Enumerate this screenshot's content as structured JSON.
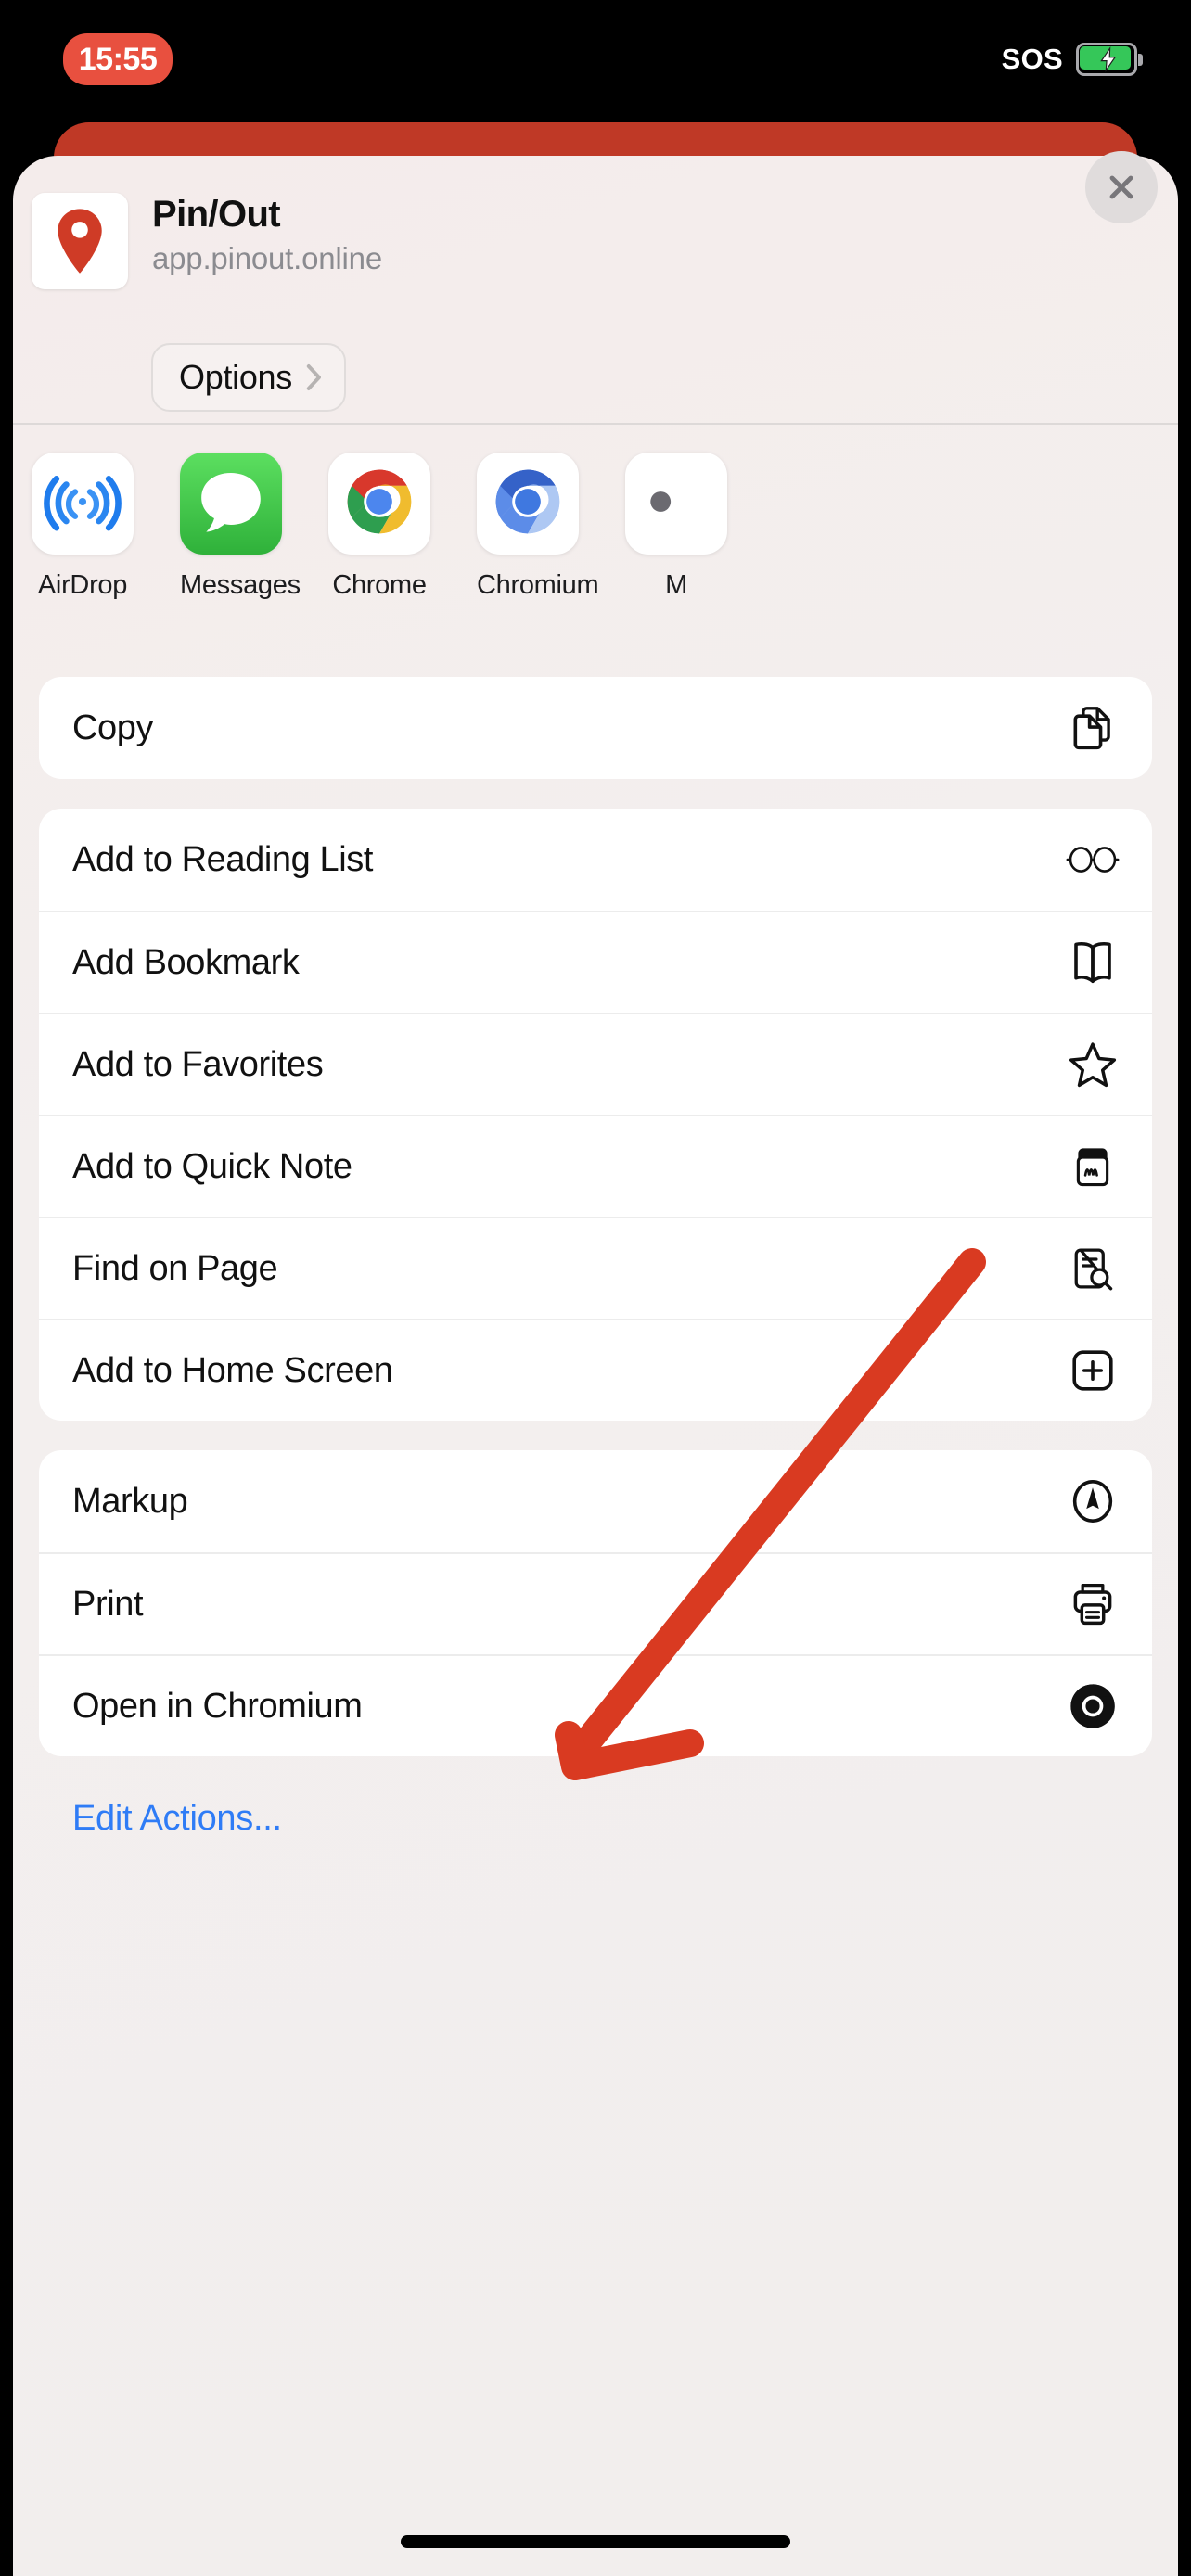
{
  "status_bar": {
    "time": "15:55",
    "sos_label": "SOS",
    "battery_icon": "battery-charging-icon",
    "time_pill_color": "#e8503f",
    "battery_color": "#35c759"
  },
  "sheet": {
    "app_icon": "map-pin-icon",
    "app_title": "Pin/Out",
    "app_url": "app.pinout.online",
    "options_label": "Options",
    "options_chevron": "chevron-right-icon",
    "close_icon": "close-icon",
    "background_color": "#f3efee"
  },
  "page_behind_color": "#bf3926",
  "share_targets": [
    {
      "label": "AirDrop",
      "icon": "airdrop-icon",
      "tile": "white"
    },
    {
      "label": "Messages",
      "icon": "messages-bubble-icon",
      "tile": "green"
    },
    {
      "label": "Chrome",
      "icon": "chrome-logo-icon",
      "tile": "white"
    },
    {
      "label": "Chromium",
      "icon": "chromium-logo-icon",
      "tile": "white"
    },
    {
      "label": "M",
      "icon": "mail-icon",
      "tile": "white"
    }
  ],
  "action_groups": [
    {
      "rows": [
        {
          "label": "Copy",
          "icon": "copy-documents-icon"
        }
      ]
    },
    {
      "rows": [
        {
          "label": "Add to Reading List",
          "icon": "glasses-icon"
        },
        {
          "label": "Add Bookmark",
          "icon": "open-book-icon"
        },
        {
          "label": "Add to Favorites",
          "icon": "star-icon"
        },
        {
          "label": "Add to Quick Note",
          "icon": "quick-note-icon"
        },
        {
          "label": "Find on Page",
          "icon": "document-search-icon"
        },
        {
          "label": "Add to Home Screen",
          "icon": "square-plus-icon"
        }
      ]
    },
    {
      "rows": [
        {
          "label": "Markup",
          "icon": "markup-pen-icon"
        },
        {
          "label": "Print",
          "icon": "printer-icon"
        },
        {
          "label": "Open in Chromium",
          "icon": "chromium-mono-icon"
        }
      ]
    }
  ],
  "edit_actions_label": "Edit Actions...",
  "annotation": {
    "type": "arrow",
    "color": "#d93a21",
    "points_at": "Add to Home Screen"
  }
}
